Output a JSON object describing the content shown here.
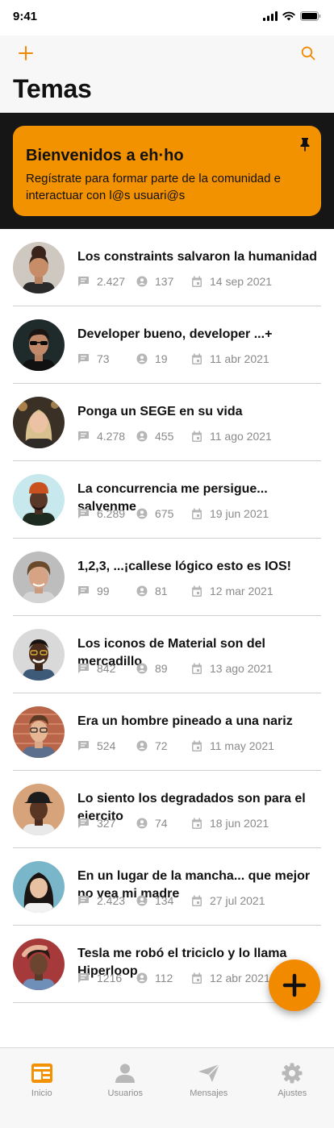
{
  "status_bar": {
    "time": "9:41"
  },
  "header": {
    "title": "Temas"
  },
  "banner": {
    "title": "Bienvenidos a eh·ho",
    "text": "Regístrate para formar parte de la comunidad e interactuar con l@s usuari@s"
  },
  "colors": {
    "accent": "#f39200",
    "banner_bg": "#161616",
    "muted": "#8a8a8a"
  },
  "topics": [
    {
      "title": "Los constraints salvaron la humanidad",
      "messages": "2.427",
      "users": "137",
      "date": "14 sep 2021"
    },
    {
      "title": "Developer bueno, developer ...+",
      "messages": "73",
      "users": "19",
      "date": "11 abr 2021"
    },
    {
      "title": "Ponga un SEGE en su vida",
      "messages": "4.278",
      "users": "455",
      "date": "11 ago 2021"
    },
    {
      "title": "La concurrencia me persigue... salvenme",
      "messages": "6.289",
      "users": "675",
      "date": "19 jun 2021"
    },
    {
      "title": "1,2,3, ...¡callese lógico esto es IOS!",
      "messages": "99",
      "users": "81",
      "date": "12 mar 2021"
    },
    {
      "title": "Los iconos de Material son del mercadillo",
      "messages": "842",
      "users": "89",
      "date": "13 ago 2021"
    },
    {
      "title": "Era un hombre pineado a una nariz",
      "messages": "524",
      "users": "72",
      "date": "11 may 2021"
    },
    {
      "title": "Lo siento los degradados son para el ejercito",
      "messages": "327",
      "users": "74",
      "date": "18 jun 2021"
    },
    {
      "title": "En un lugar de la mancha... que mejor no vea mi madre",
      "messages": "2.423",
      "users": "134",
      "date": "27 jul 2021"
    },
    {
      "title": "Tesla me robó el triciclo y lo llama Hiperloop",
      "messages": "1216",
      "users": "112",
      "date": "12 abr 2021"
    }
  ],
  "tabs": [
    {
      "label": "Inicio",
      "icon": "home-icon",
      "active": true
    },
    {
      "label": "Usuarios",
      "icon": "user-icon"
    },
    {
      "label": "Mensajes",
      "icon": "send-icon"
    },
    {
      "label": "Ajustes",
      "icon": "gear-icon"
    }
  ]
}
